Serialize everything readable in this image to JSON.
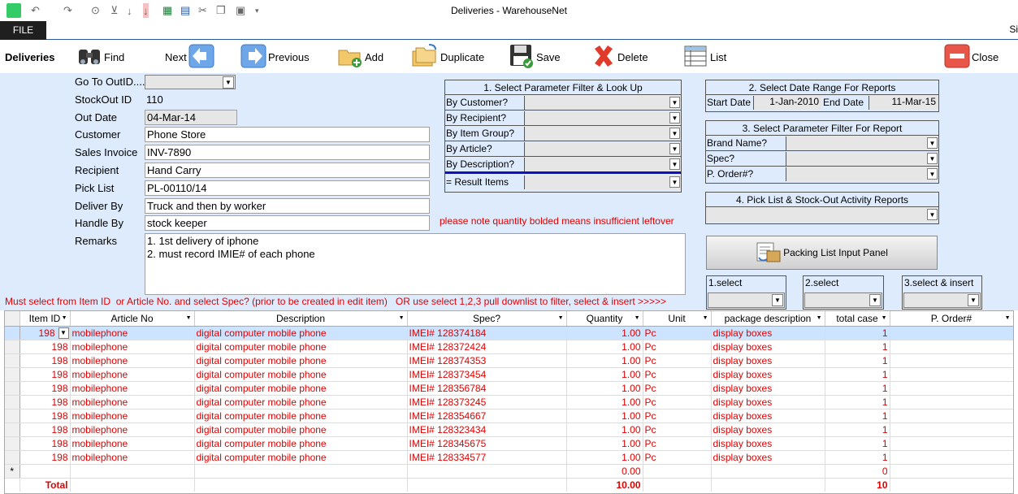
{
  "window": {
    "title": "Deliveries - WarehouseNet",
    "file_tab": "FILE",
    "signin": "Si"
  },
  "toolbar": {
    "module": "Deliveries",
    "find": "Find",
    "next": "Next",
    "previous": "Previous",
    "add": "Add",
    "duplicate": "Duplicate",
    "save": "Save",
    "delete": "Delete",
    "list": "List",
    "close": "Close"
  },
  "form": {
    "goto_label": "Go To OutID.....",
    "stockout_label": "StockOut ID",
    "stockout_value": "110",
    "outdate_label": "Out Date",
    "outdate_value": "04-Mar-14",
    "customer_label": "Customer",
    "customer_value": "Phone Store",
    "invoice_label": "Sales Invoice",
    "invoice_value": "INV-7890",
    "recipient_label": "Recipient",
    "recipient_value": "Hand Carry",
    "picklist_label": "Pick List",
    "picklist_value": "PL-00110/14",
    "deliverby_label": "Deliver By",
    "deliverby_value": "Truck and then by worker",
    "handleby_label": "Handle By",
    "handleby_value": "stock keeper",
    "remarks_label": "Remarks",
    "remarks_line1": "1. 1st delivery of iphone",
    "remarks_line2": "2. must record IMIE# of each phone",
    "note": "please note quantity bolded means insufficient leftover",
    "instruction": "Must select from Item ID  or Article No. and select Spec? (prior to be created in edit item)   OR use select 1,2,3 pull downlist to filter, select & insert >>>>>"
  },
  "panel1": {
    "title": "1. Select Parameter Filter & Look Up",
    "rows": [
      "By Customer?",
      "By Recipient?",
      "By Item Group?",
      "By Article?",
      "By Description?"
    ],
    "result": "= Result Items"
  },
  "panel2": {
    "title": "2. Select Date Range For  Reports",
    "start_label": "Start Date",
    "start_value": "1-Jan-2010",
    "end_label": "End Date",
    "end_value": "11-Mar-15"
  },
  "panel3": {
    "title": "3. Select Parameter Filter For Report",
    "rows": [
      "Brand Name?",
      "Spec?",
      "P. Order#?"
    ]
  },
  "panel4": {
    "title": "4. Pick List & Stock-Out Activity Reports"
  },
  "packing_button": "Packing List Input Panel",
  "selects": {
    "s1": "1.select",
    "s2": "2.select",
    "s3": "3.select & insert"
  },
  "grid": {
    "headers": [
      "Item ID",
      "Article No",
      "Description",
      "Spec?",
      "Quantity",
      "Unit",
      "package description",
      "total case",
      "P. Order#"
    ],
    "rows": [
      [
        "198",
        "mobilephone",
        "digital computer mobile phone",
        "IMEI# 128374184",
        "1.00",
        "Pc",
        "display boxes",
        "1"
      ],
      [
        "198",
        "mobilephone",
        "digital computer mobile phone",
        "IMEI# 128372424",
        "1.00",
        "Pc",
        "display boxes",
        "1"
      ],
      [
        "198",
        "mobilephone",
        "digital computer mobile phone",
        "IMEI# 128374353",
        "1.00",
        "Pc",
        "display boxes",
        "1"
      ],
      [
        "198",
        "mobilephone",
        "digital computer mobile phone",
        "IMEI# 128373454",
        "1.00",
        "Pc",
        "display boxes",
        "1"
      ],
      [
        "198",
        "mobilephone",
        "digital computer mobile phone",
        "IMEI# 128356784",
        "1.00",
        "Pc",
        "display boxes",
        "1"
      ],
      [
        "198",
        "mobilephone",
        "digital computer mobile phone",
        "IMEI# 128373245",
        "1.00",
        "Pc",
        "display boxes",
        "1"
      ],
      [
        "198",
        "mobilephone",
        "digital computer mobile phone",
        "IMEI# 128354667",
        "1.00",
        "Pc",
        "display boxes",
        "1"
      ],
      [
        "198",
        "mobilephone",
        "digital computer mobile phone",
        "IMEI# 128323434",
        "1.00",
        "Pc",
        "display boxes",
        "1"
      ],
      [
        "198",
        "mobilephone",
        "digital computer mobile phone",
        "IMEI# 128345675",
        "1.00",
        "Pc",
        "display boxes",
        "1"
      ],
      [
        "198",
        "mobilephone",
        "digital computer mobile phone",
        "IMEI# 128334577",
        "1.00",
        "Pc",
        "display boxes",
        "1"
      ]
    ],
    "new_row": {
      "marker": "*",
      "quantity": "0.00",
      "cases": "0"
    },
    "total": {
      "label": "Total",
      "quantity": "10.00",
      "cases": "10"
    }
  },
  "colors": {
    "form_bg": "#ddebfd",
    "red_text": "#e00000",
    "ribbon_border": "#2b579a"
  }
}
